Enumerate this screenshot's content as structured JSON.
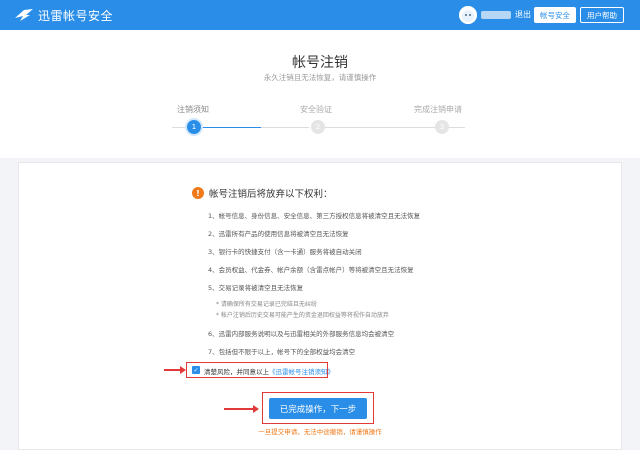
{
  "header": {
    "logo_text": "迅雷帐号安全",
    "logout": "退出",
    "account_security": "帐号安全",
    "help": "用户帮助"
  },
  "page": {
    "title": "帐号注销",
    "subtitle": "永久注销且无法恢复，请谨慎操作"
  },
  "steps": [
    {
      "label": "注销须知",
      "number": "1"
    },
    {
      "label": "安全验证",
      "number": "2"
    },
    {
      "label": "完成注销申请",
      "number": "3"
    }
  ],
  "notice": {
    "title": "帐号注销后将放弃以下权利：",
    "items": [
      "1、帐号信息、身份信息、安全信息、第三方授权信息将被清空且无法恢复",
      "2、迅雷所有产品的使用信息将被清空且无法恢复",
      "3、银行卡的快捷支付（含一卡通）服务将被自动关闭",
      "4、会员权益、代金券、帐户余额（含雷点帐户）等将被清空且无法恢复",
      "5、交易记录将被清空且无法恢复",
      "6、迅雷内部服务说明以及与迅雷相关的外部服务信息均会被清空",
      "7、包括但不限于以上，帐号下的全部权益均会清空"
    ],
    "notes": [
      "* 请确保所有交易记录已完结且无纠纷",
      "* 帐户注销后历史交易可能产生的资金退回权益等将视作自动放弃"
    ]
  },
  "agree": {
    "text": "清楚风险，并同意以上",
    "link": "《迅雷帐号注销须知》"
  },
  "next_button": "已完成操作，下一步",
  "footer_warning": "一旦提交申请，无法中途撤销，请谨慎操作",
  "colors": {
    "brand": "#2a8ee8",
    "warning": "#f07a1a",
    "highlight": "#e23a3a"
  }
}
